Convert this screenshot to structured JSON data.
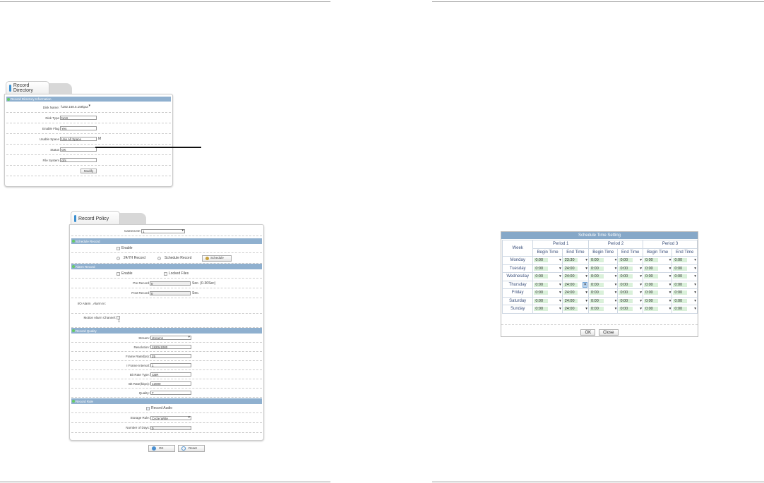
{
  "record_directory": {
    "tab": "Record Directory",
    "section": "Record Directory Information",
    "fields": [
      {
        "label": "Disk Name:",
        "value": "\\\\192.168.5.158\\put",
        "type": "select"
      },
      {
        "label": "Disk Type",
        "value": "NAS",
        "type": "text"
      },
      {
        "label": "Enable Flag",
        "value": "Yes",
        "type": "text"
      },
      {
        "label": "Usable Space",
        "value": "Use All Space",
        "type": "text",
        "unit": "M"
      },
      {
        "label": "Status",
        "value": "OK",
        "type": "text"
      },
      {
        "label": "File System",
        "value": "cifs",
        "type": "text"
      }
    ],
    "modify_button": "Modify"
  },
  "record_policy": {
    "tab": "Record Policy",
    "camera_id_label": "Camera ID:",
    "camera_id": "1",
    "schedule_section": "Schedule Record",
    "schedule_enable": "Enable",
    "radio_247": "24/7H Record",
    "radio_schedule": "Schedule Record",
    "schedule_button": "Schedule",
    "alarm_section": "Alarm Record",
    "alarm_enable": "Enable",
    "locked_files": "Locked Files",
    "pre_record_label": "Pre Record",
    "pre_record": "0",
    "pre_record_unit": "Sec. (0-30Sec)",
    "post_record_label": "Post Record",
    "post_record": "0",
    "post_record_unit": "Sec.",
    "io_alarm": "I/O Alarm , Alarm In:",
    "motion_alarm": "Motion Alarm Channel:",
    "motion_channel": "1",
    "quality_section": "Record Quality",
    "quality_fields": [
      {
        "label": "Stream:",
        "value": "stream1",
        "type": "select"
      },
      {
        "label": "Resolution:",
        "value": "1920x1080",
        "type": "text"
      },
      {
        "label": "Frame Rate(fps):",
        "value": "25",
        "type": "text"
      },
      {
        "label": "I Frame Interval:",
        "value": "1",
        "type": "text"
      },
      {
        "label": "Bit Rate Type:",
        "value": "CBR",
        "type": "text"
      },
      {
        "label": "Bit Rate(kbps):",
        "value": "12000",
        "type": "text"
      },
      {
        "label": "Quality:",
        "value": "7",
        "type": "text"
      }
    ],
    "rule_section": "Record Rule",
    "record_audio": "Record Audio",
    "storage_rule_label": "Storage Rule:",
    "storage_rule": "Cycle Write",
    "days_label": "Number of Days:",
    "days": "0",
    "ok_button": "OK",
    "reset_button": "Reset"
  },
  "schedule": {
    "title": "Schedule Time Setting",
    "week_header": "Week",
    "periods": [
      "Period 1",
      "Period 2",
      "Period 3"
    ],
    "begin": "Begin Time",
    "end": "End Time",
    "rows": [
      {
        "day": "Monday",
        "times": [
          "0:00",
          "23:30",
          "0:00",
          "0:00",
          "0:00",
          "0:00"
        ]
      },
      {
        "day": "Tuesday",
        "times": [
          "0:00",
          "24:00",
          "0:00",
          "0:00",
          "0:00",
          "0:00"
        ]
      },
      {
        "day": "Wednesday",
        "times": [
          "0:00",
          "24:00",
          "0:00",
          "0:00",
          "0:00",
          "0:00"
        ]
      },
      {
        "day": "Thursday",
        "times": [
          "0:00",
          "24:00",
          "0:00",
          "0:00",
          "0:00",
          "0:00"
        ]
      },
      {
        "day": "Friday",
        "times": [
          "0:00",
          "24:00",
          "0:00",
          "0:00",
          "0:00",
          "0:00"
        ]
      },
      {
        "day": "Saturday",
        "times": [
          "0:00",
          "24:00",
          "0:00",
          "0:00",
          "0:00",
          "0:00"
        ]
      },
      {
        "day": "Sunday",
        "times": [
          "0:00",
          "24:00",
          "0:00",
          "0:00",
          "0:00",
          "0:00"
        ]
      }
    ],
    "ok_button": "OK",
    "close_button": "Close"
  }
}
